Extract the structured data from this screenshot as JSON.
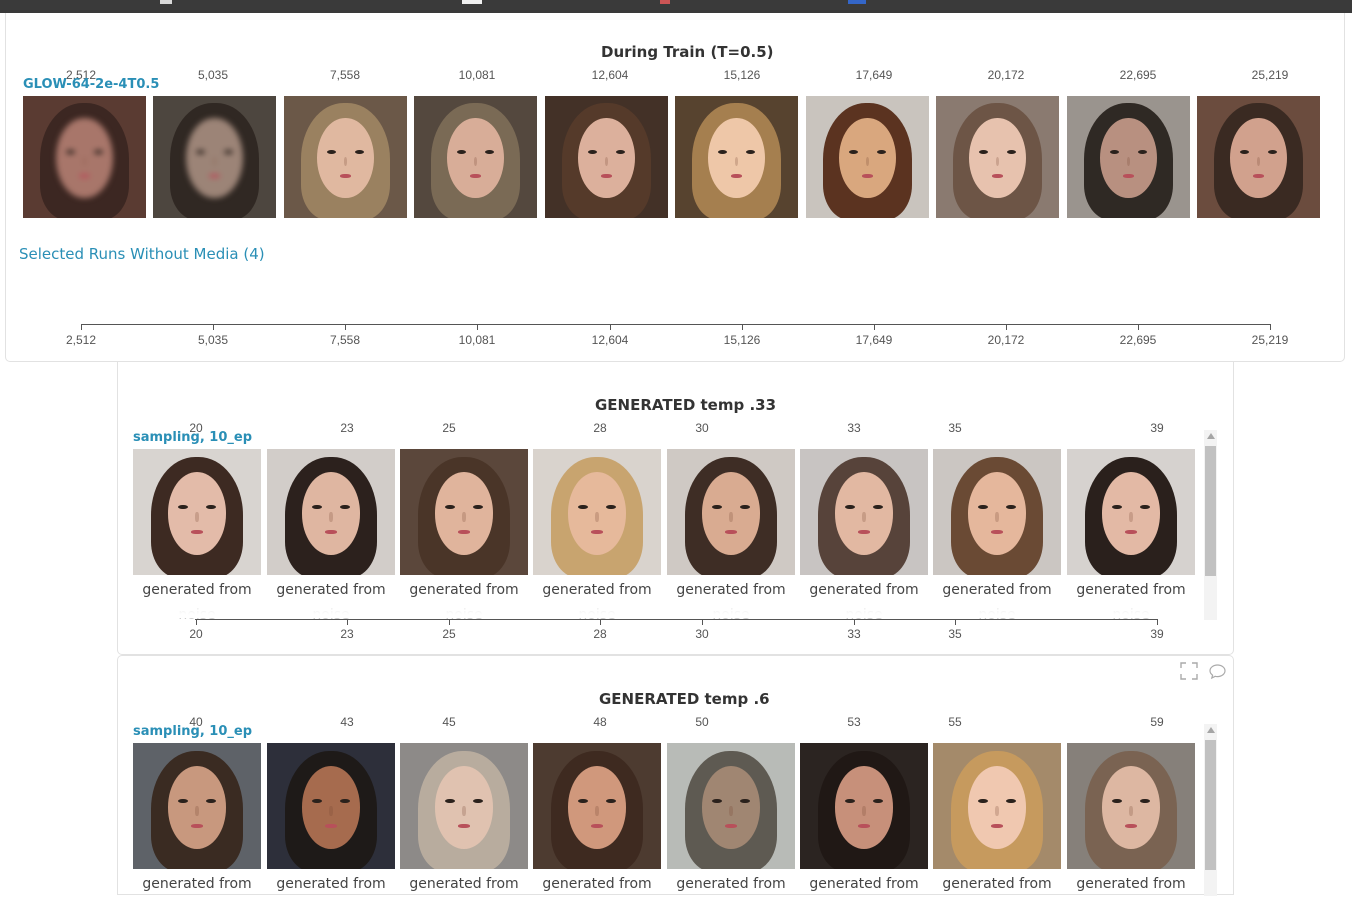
{
  "panel_during_train": {
    "title": "During Train (T=0.5)",
    "run_name": "GLOW-64-2e-4T0.5",
    "steps": [
      "2,512",
      "5,035",
      "7,558",
      "10,081",
      "12,604",
      "15,126",
      "17,649",
      "20,172",
      "22,695",
      "25,219"
    ],
    "selected_runs_link": "Selected Runs Without Media (4)",
    "axis_ticks": [
      "2,512",
      "5,035",
      "7,558",
      "10,081",
      "12,604",
      "15,126",
      "17,649",
      "20,172",
      "22,695",
      "25,219"
    ]
  },
  "panel_temp_033": {
    "title": "GENERATED temp .33",
    "run_name": "sampling, 10_ep",
    "steps": [
      "20",
      "23",
      "25",
      "28",
      "30",
      "33",
      "35",
      "39"
    ],
    "caption_line1": "generated from",
    "caption_line2": "noise",
    "axis_ticks": [
      "20",
      "23",
      "25",
      "28",
      "30",
      "33",
      "35",
      "39"
    ]
  },
  "panel_temp_06": {
    "title": "GENERATED temp .6",
    "run_name": "sampling, 10_ep",
    "steps": [
      "40",
      "43",
      "45",
      "48",
      "50",
      "53",
      "55",
      "59"
    ],
    "caption_line1": "generated from",
    "toolbar_icons": [
      "fullscreen-icon",
      "comment-icon"
    ]
  },
  "colors": {
    "accent": "#2a8fb6",
    "topbar": "#3a3a3a"
  }
}
